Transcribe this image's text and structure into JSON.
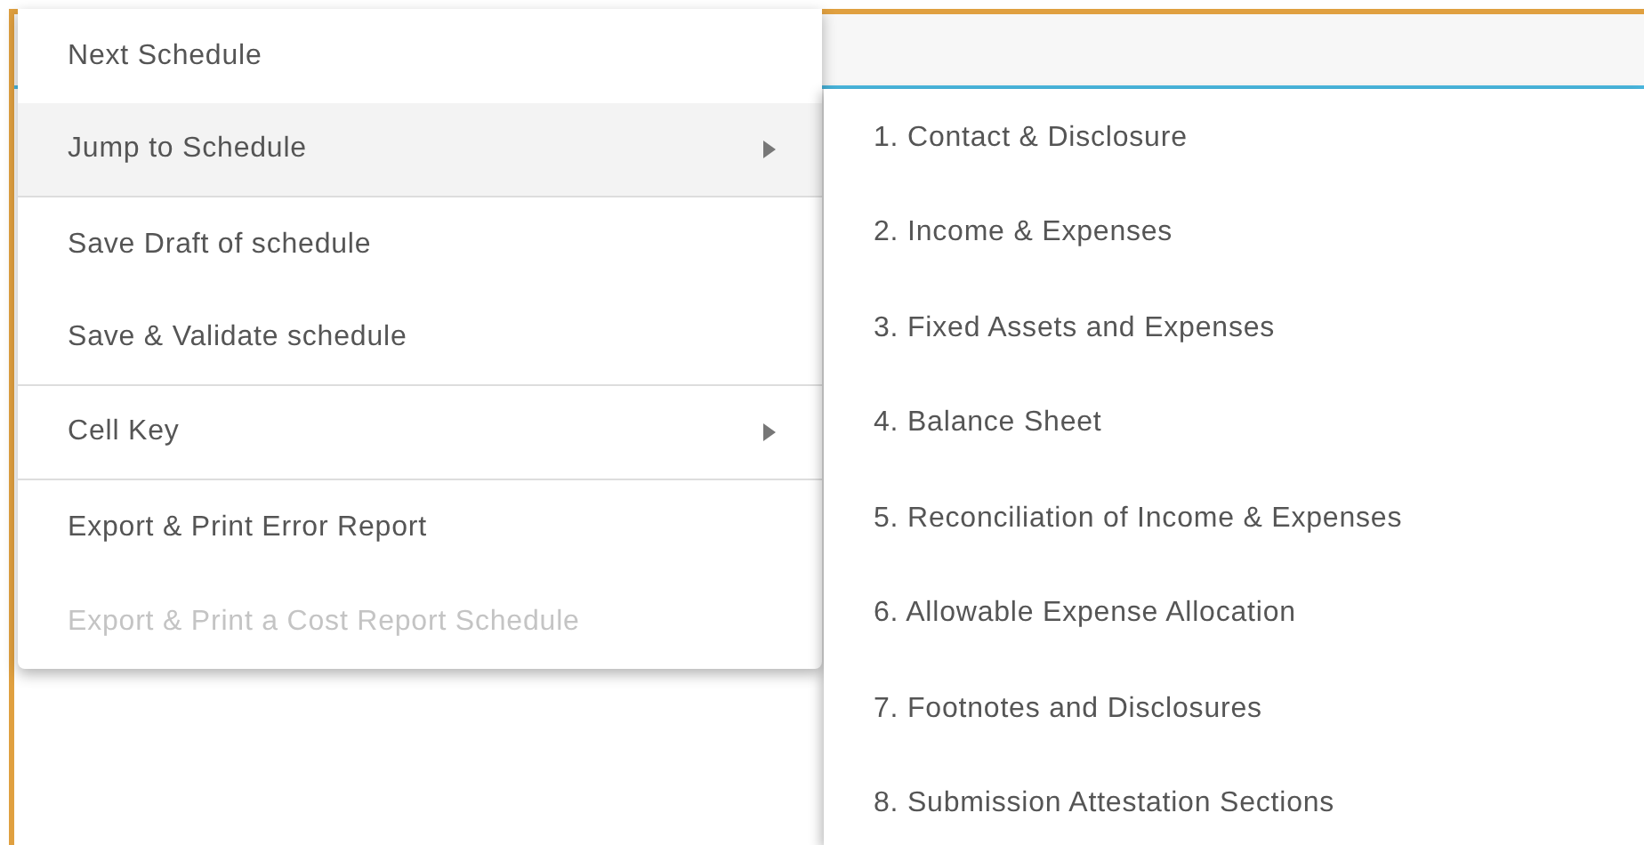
{
  "context_menu": {
    "items": [
      {
        "label": "Next Schedule",
        "selected": false,
        "has_submenu": false,
        "disabled": false,
        "divider_after": false
      },
      {
        "label": "Jump to Schedule",
        "selected": true,
        "has_submenu": true,
        "disabled": false,
        "divider_after": true
      },
      {
        "label": "Save Draft of schedule",
        "selected": false,
        "has_submenu": false,
        "disabled": false,
        "divider_after": false
      },
      {
        "label": "Save & Validate schedule",
        "selected": false,
        "has_submenu": false,
        "disabled": false,
        "divider_after": true
      },
      {
        "label": "Cell Key",
        "selected": false,
        "has_submenu": true,
        "disabled": false,
        "divider_after": true
      },
      {
        "label": "Export & Print Error Report",
        "selected": false,
        "has_submenu": false,
        "disabled": false,
        "divider_after": false
      },
      {
        "label": "Export & Print a Cost Report Schedule",
        "selected": false,
        "has_submenu": false,
        "disabled": true,
        "divider_after": false
      }
    ]
  },
  "submenu": {
    "items": [
      "1. Contact & Disclosure",
      "2. Income & Expenses",
      "3. Fixed Assets and Expenses",
      "4. Balance Sheet",
      "5. Reconciliation of Income & Expenses",
      "6. Allowable Expense Allocation",
      "7. Footnotes and Disclosures",
      "8. Submission Attestation Sections"
    ]
  }
}
